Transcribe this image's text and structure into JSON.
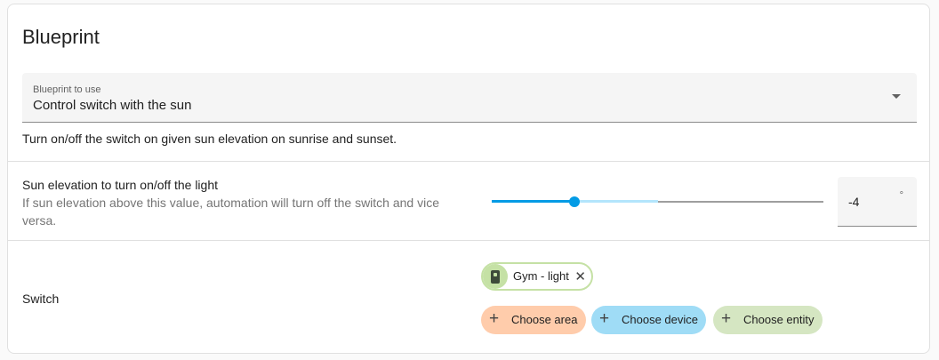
{
  "card": {
    "title": "Blueprint"
  },
  "blueprint_select": {
    "label": "Blueprint to use",
    "value": "Control switch with the sun"
  },
  "blueprint_description": "Turn on/off the switch on given sun elevation on sunrise and sunset.",
  "sun_elevation": {
    "title": "Sun elevation to turn on/off the light",
    "description": "If sun elevation above this value, automation will turn off the switch and vice versa.",
    "value": "-4",
    "suffix": "°",
    "slider_fraction": 0.25
  },
  "switch_input": {
    "label": "Switch",
    "selected": [
      {
        "label": "Gym - light",
        "icon": "light-switch-icon",
        "remove_icon": "close-icon"
      }
    ],
    "add_buttons": {
      "area": "Choose area",
      "device": "Choose device",
      "entity": "Choose entity"
    }
  },
  "colors": {
    "accent": "#039be5",
    "area_chip": "#ffccab",
    "device_chip": "#9fdcf6",
    "entity_chip": "#d5e6c2"
  }
}
